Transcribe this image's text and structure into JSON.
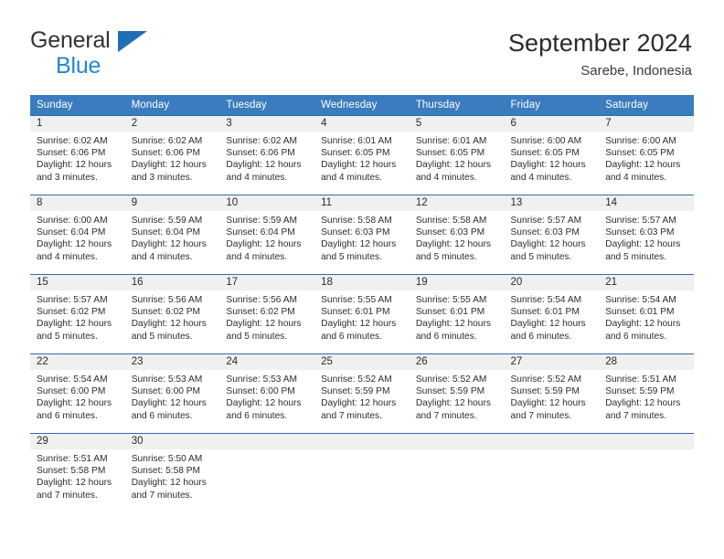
{
  "brand": {
    "line1": "General",
    "line2": "Blue",
    "triangle_color": "#1f6fb5",
    "blue_text_color": "#2087d6"
  },
  "header": {
    "title": "September 2024",
    "subtitle": "Sarebe, Indonesia"
  },
  "colors": {
    "header_row_background": "#3a7cbe",
    "header_row_text": "#ffffff",
    "daynum_band": "#f0f0f0",
    "week_divider": "#2a6fae"
  },
  "weekday_headers": [
    "Sunday",
    "Monday",
    "Tuesday",
    "Wednesday",
    "Thursday",
    "Friday",
    "Saturday"
  ],
  "weeks": [
    [
      {
        "day": "1",
        "sunrise": "Sunrise: 6:02 AM",
        "sunset": "Sunset: 6:06 PM",
        "daylight1": "Daylight: 12 hours",
        "daylight2": "and 3 minutes."
      },
      {
        "day": "2",
        "sunrise": "Sunrise: 6:02 AM",
        "sunset": "Sunset: 6:06 PM",
        "daylight1": "Daylight: 12 hours",
        "daylight2": "and 3 minutes."
      },
      {
        "day": "3",
        "sunrise": "Sunrise: 6:02 AM",
        "sunset": "Sunset: 6:06 PM",
        "daylight1": "Daylight: 12 hours",
        "daylight2": "and 4 minutes."
      },
      {
        "day": "4",
        "sunrise": "Sunrise: 6:01 AM",
        "sunset": "Sunset: 6:05 PM",
        "daylight1": "Daylight: 12 hours",
        "daylight2": "and 4 minutes."
      },
      {
        "day": "5",
        "sunrise": "Sunrise: 6:01 AM",
        "sunset": "Sunset: 6:05 PM",
        "daylight1": "Daylight: 12 hours",
        "daylight2": "and 4 minutes."
      },
      {
        "day": "6",
        "sunrise": "Sunrise: 6:00 AM",
        "sunset": "Sunset: 6:05 PM",
        "daylight1": "Daylight: 12 hours",
        "daylight2": "and 4 minutes."
      },
      {
        "day": "7",
        "sunrise": "Sunrise: 6:00 AM",
        "sunset": "Sunset: 6:05 PM",
        "daylight1": "Daylight: 12 hours",
        "daylight2": "and 4 minutes."
      }
    ],
    [
      {
        "day": "8",
        "sunrise": "Sunrise: 6:00 AM",
        "sunset": "Sunset: 6:04 PM",
        "daylight1": "Daylight: 12 hours",
        "daylight2": "and 4 minutes."
      },
      {
        "day": "9",
        "sunrise": "Sunrise: 5:59 AM",
        "sunset": "Sunset: 6:04 PM",
        "daylight1": "Daylight: 12 hours",
        "daylight2": "and 4 minutes."
      },
      {
        "day": "10",
        "sunrise": "Sunrise: 5:59 AM",
        "sunset": "Sunset: 6:04 PM",
        "daylight1": "Daylight: 12 hours",
        "daylight2": "and 4 minutes."
      },
      {
        "day": "11",
        "sunrise": "Sunrise: 5:58 AM",
        "sunset": "Sunset: 6:03 PM",
        "daylight1": "Daylight: 12 hours",
        "daylight2": "and 5 minutes."
      },
      {
        "day": "12",
        "sunrise": "Sunrise: 5:58 AM",
        "sunset": "Sunset: 6:03 PM",
        "daylight1": "Daylight: 12 hours",
        "daylight2": "and 5 minutes."
      },
      {
        "day": "13",
        "sunrise": "Sunrise: 5:57 AM",
        "sunset": "Sunset: 6:03 PM",
        "daylight1": "Daylight: 12 hours",
        "daylight2": "and 5 minutes."
      },
      {
        "day": "14",
        "sunrise": "Sunrise: 5:57 AM",
        "sunset": "Sunset: 6:03 PM",
        "daylight1": "Daylight: 12 hours",
        "daylight2": "and 5 minutes."
      }
    ],
    [
      {
        "day": "15",
        "sunrise": "Sunrise: 5:57 AM",
        "sunset": "Sunset: 6:02 PM",
        "daylight1": "Daylight: 12 hours",
        "daylight2": "and 5 minutes."
      },
      {
        "day": "16",
        "sunrise": "Sunrise: 5:56 AM",
        "sunset": "Sunset: 6:02 PM",
        "daylight1": "Daylight: 12 hours",
        "daylight2": "and 5 minutes."
      },
      {
        "day": "17",
        "sunrise": "Sunrise: 5:56 AM",
        "sunset": "Sunset: 6:02 PM",
        "daylight1": "Daylight: 12 hours",
        "daylight2": "and 5 minutes."
      },
      {
        "day": "18",
        "sunrise": "Sunrise: 5:55 AM",
        "sunset": "Sunset: 6:01 PM",
        "daylight1": "Daylight: 12 hours",
        "daylight2": "and 6 minutes."
      },
      {
        "day": "19",
        "sunrise": "Sunrise: 5:55 AM",
        "sunset": "Sunset: 6:01 PM",
        "daylight1": "Daylight: 12 hours",
        "daylight2": "and 6 minutes."
      },
      {
        "day": "20",
        "sunrise": "Sunrise: 5:54 AM",
        "sunset": "Sunset: 6:01 PM",
        "daylight1": "Daylight: 12 hours",
        "daylight2": "and 6 minutes."
      },
      {
        "day": "21",
        "sunrise": "Sunrise: 5:54 AM",
        "sunset": "Sunset: 6:01 PM",
        "daylight1": "Daylight: 12 hours",
        "daylight2": "and 6 minutes."
      }
    ],
    [
      {
        "day": "22",
        "sunrise": "Sunrise: 5:54 AM",
        "sunset": "Sunset: 6:00 PM",
        "daylight1": "Daylight: 12 hours",
        "daylight2": "and 6 minutes."
      },
      {
        "day": "23",
        "sunrise": "Sunrise: 5:53 AM",
        "sunset": "Sunset: 6:00 PM",
        "daylight1": "Daylight: 12 hours",
        "daylight2": "and 6 minutes."
      },
      {
        "day": "24",
        "sunrise": "Sunrise: 5:53 AM",
        "sunset": "Sunset: 6:00 PM",
        "daylight1": "Daylight: 12 hours",
        "daylight2": "and 6 minutes."
      },
      {
        "day": "25",
        "sunrise": "Sunrise: 5:52 AM",
        "sunset": "Sunset: 5:59 PM",
        "daylight1": "Daylight: 12 hours",
        "daylight2": "and 7 minutes."
      },
      {
        "day": "26",
        "sunrise": "Sunrise: 5:52 AM",
        "sunset": "Sunset: 5:59 PM",
        "daylight1": "Daylight: 12 hours",
        "daylight2": "and 7 minutes."
      },
      {
        "day": "27",
        "sunrise": "Sunrise: 5:52 AM",
        "sunset": "Sunset: 5:59 PM",
        "daylight1": "Daylight: 12 hours",
        "daylight2": "and 7 minutes."
      },
      {
        "day": "28",
        "sunrise": "Sunrise: 5:51 AM",
        "sunset": "Sunset: 5:59 PM",
        "daylight1": "Daylight: 12 hours",
        "daylight2": "and 7 minutes."
      }
    ],
    [
      {
        "day": "29",
        "sunrise": "Sunrise: 5:51 AM",
        "sunset": "Sunset: 5:58 PM",
        "daylight1": "Daylight: 12 hours",
        "daylight2": "and 7 minutes."
      },
      {
        "day": "30",
        "sunrise": "Sunrise: 5:50 AM",
        "sunset": "Sunset: 5:58 PM",
        "daylight1": "Daylight: 12 hours",
        "daylight2": "and 7 minutes."
      },
      {
        "day": "",
        "sunrise": "",
        "sunset": "",
        "daylight1": "",
        "daylight2": ""
      },
      {
        "day": "",
        "sunrise": "",
        "sunset": "",
        "daylight1": "",
        "daylight2": ""
      },
      {
        "day": "",
        "sunrise": "",
        "sunset": "",
        "daylight1": "",
        "daylight2": ""
      },
      {
        "day": "",
        "sunrise": "",
        "sunset": "",
        "daylight1": "",
        "daylight2": ""
      },
      {
        "day": "",
        "sunrise": "",
        "sunset": "",
        "daylight1": "",
        "daylight2": ""
      }
    ]
  ]
}
